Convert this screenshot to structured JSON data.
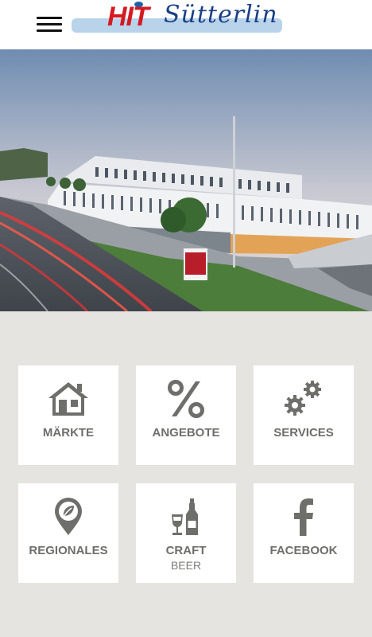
{
  "header": {
    "logo_primary": "HIT",
    "logo_secondary": "Sütterlin"
  },
  "tiles": [
    {
      "label": "MÄRKTE",
      "icon": "house-icon"
    },
    {
      "label": "ANGEBOTE",
      "icon": "percent-icon"
    },
    {
      "label": "SERVICES",
      "icon": "gears-icon"
    },
    {
      "label": "REGIONALES",
      "icon": "location-leaf-icon"
    },
    {
      "label": "CRAFT",
      "sublabel": "BEER",
      "icon": "beer-bottle-glass-icon"
    },
    {
      "label": "FACEBOOK",
      "icon": "facebook-icon"
    }
  ],
  "colors": {
    "background": "#e5e4e1",
    "tile": "#ffffff",
    "icon": "#6e6e6b",
    "brand_red": "#d51a22",
    "brand_blue": "#1a3f86"
  }
}
